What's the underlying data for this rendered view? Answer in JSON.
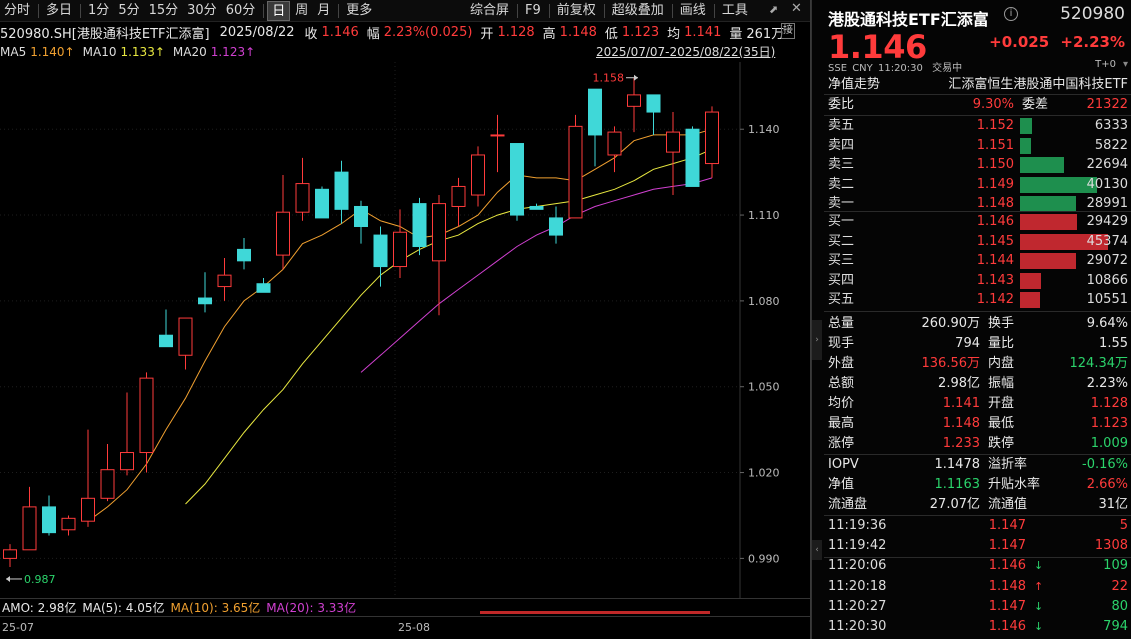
{
  "toolbar": {
    "periods": [
      "分时",
      "多日",
      "1分",
      "5分",
      "15分",
      "30分",
      "60分",
      "日",
      "周",
      "月",
      "更多"
    ],
    "active_period": "日",
    "tools": [
      "综合屏",
      "F9",
      "前复权",
      "超级叠加",
      "画线",
      "工具"
    ]
  },
  "info": {
    "code_name": "520980.SH[港股通科技ETF汇添富]",
    "date": "2025/08/22",
    "close_label": "收",
    "close": "1.146",
    "change_label": "幅",
    "change": "2.23%(0.025)",
    "open_label": "开",
    "open": "1.128",
    "high_label": "高",
    "high": "1.148",
    "low_label": "低",
    "low": "1.123",
    "avg_label": "均",
    "avg": "1.141",
    "vol_label": "量",
    "vol": "261万",
    "range": "2025/07/07-2025/08/22(35日)"
  },
  "ma": {
    "ma5_label": "MA5",
    "ma5": "1.140↑",
    "ma10_label": "MA10",
    "ma10": "1.133↑",
    "ma20_label": "MA20",
    "ma20": "1.123↑"
  },
  "colors": {
    "up": "#ff3b3b",
    "down": "#3fd8d8",
    "ma5": "#f0a030",
    "ma10": "#e8e840",
    "ma20": "#d040d0",
    "bid_bar": "#c0282f",
    "ask_bar": "#1e8f4e"
  },
  "chart_data": {
    "type": "candlestick",
    "ylim": [
      0.98,
      1.16
    ],
    "yticks": [
      "1.140",
      "1.110",
      "1.080",
      "1.050",
      "1.020",
      "0.990"
    ],
    "ytick_values": [
      1.14,
      1.11,
      1.08,
      1.05,
      1.02,
      0.99
    ],
    "xlabels": [
      "25-07",
      "25-08"
    ],
    "max_label": "1.158",
    "min_label": "0.987",
    "candles": [
      {
        "o": 0.99,
        "h": 0.995,
        "l": 0.987,
        "c": 0.993
      },
      {
        "o": 0.993,
        "h": 1.015,
        "l": 0.993,
        "c": 1.008
      },
      {
        "o": 1.008,
        "h": 1.012,
        "l": 0.998,
        "c": 0.999
      },
      {
        "o": 1.0,
        "h": 1.005,
        "l": 0.998,
        "c": 1.004
      },
      {
        "o": 1.003,
        "h": 1.035,
        "l": 1.001,
        "c": 1.011
      },
      {
        "o": 1.011,
        "h": 1.03,
        "l": 1.01,
        "c": 1.021
      },
      {
        "o": 1.021,
        "h": 1.048,
        "l": 1.019,
        "c": 1.027
      },
      {
        "o": 1.027,
        "h": 1.055,
        "l": 1.02,
        "c": 1.053
      },
      {
        "o": 1.068,
        "h": 1.077,
        "l": 1.066,
        "c": 1.064
      },
      {
        "o": 1.061,
        "h": 1.07,
        "l": 1.056,
        "c": 1.074
      },
      {
        "o": 1.081,
        "h": 1.09,
        "l": 1.076,
        "c": 1.079
      },
      {
        "o": 1.085,
        "h": 1.095,
        "l": 1.08,
        "c": 1.089
      },
      {
        "o": 1.098,
        "h": 1.102,
        "l": 1.091,
        "c": 1.094
      },
      {
        "o": 1.086,
        "h": 1.088,
        "l": 1.083,
        "c": 1.083
      },
      {
        "o": 1.096,
        "h": 1.124,
        "l": 1.091,
        "c": 1.111
      },
      {
        "o": 1.111,
        "h": 1.13,
        "l": 1.108,
        "c": 1.121
      },
      {
        "o": 1.119,
        "h": 1.12,
        "l": 1.11,
        "c": 1.109
      },
      {
        "o": 1.125,
        "h": 1.129,
        "l": 1.107,
        "c": 1.112
      },
      {
        "o": 1.113,
        "h": 1.115,
        "l": 1.1,
        "c": 1.106
      },
      {
        "o": 1.103,
        "h": 1.106,
        "l": 1.085,
        "c": 1.092
      },
      {
        "o": 1.092,
        "h": 1.112,
        "l": 1.088,
        "c": 1.104
      },
      {
        "o": 1.114,
        "h": 1.116,
        "l": 1.096,
        "c": 1.099
      },
      {
        "o": 1.094,
        "h": 1.117,
        "l": 1.075,
        "c": 1.114
      },
      {
        "o": 1.113,
        "h": 1.123,
        "l": 1.106,
        "c": 1.12
      },
      {
        "o": 1.117,
        "h": 1.134,
        "l": 1.113,
        "c": 1.131
      },
      {
        "o": 1.138,
        "h": 1.145,
        "l": 1.125,
        "c": 1.138
      },
      {
        "o": 1.135,
        "h": 1.132,
        "l": 1.108,
        "c": 1.11
      },
      {
        "o": 1.113,
        "h": 1.114,
        "l": 1.112,
        "c": 1.112
      },
      {
        "o": 1.109,
        "h": 1.113,
        "l": 1.1,
        "c": 1.103
      },
      {
        "o": 1.109,
        "h": 1.145,
        "l": 1.11,
        "c": 1.141
      },
      {
        "o": 1.154,
        "h": 1.154,
        "l": 1.127,
        "c": 1.138
      },
      {
        "o": 1.131,
        "h": 1.141,
        "l": 1.125,
        "c": 1.139
      },
      {
        "o": 1.148,
        "h": 1.158,
        "l": 1.139,
        "c": 1.152
      },
      {
        "o": 1.152,
        "h": 1.152,
        "l": 1.138,
        "c": 1.146
      },
      {
        "o": 1.132,
        "h": 1.146,
        "l": 1.117,
        "c": 1.139
      },
      {
        "o": 1.14,
        "h": 1.141,
        "l": 1.12,
        "c": 1.12
      },
      {
        "o": 1.128,
        "h": 1.148,
        "l": 1.123,
        "c": 1.146
      }
    ],
    "ma5": [
      null,
      null,
      null,
      null,
      1.003,
      1.008,
      1.014,
      1.023,
      1.035,
      1.046,
      1.059,
      1.071,
      1.08,
      1.085,
      1.091,
      1.1,
      1.103,
      1.107,
      1.112,
      1.108,
      1.106,
      1.102,
      1.103,
      1.106,
      1.11,
      1.118,
      1.124,
      1.123,
      1.123,
      1.122,
      1.126,
      1.13,
      1.136,
      1.138,
      1.138,
      1.138,
      1.14
    ],
    "ma10": [
      null,
      null,
      null,
      null,
      null,
      null,
      null,
      null,
      null,
      1.009,
      1.016,
      1.025,
      1.034,
      1.042,
      1.049,
      1.058,
      1.066,
      1.074,
      1.082,
      1.089,
      1.094,
      1.098,
      1.101,
      1.103,
      1.107,
      1.11,
      1.112,
      1.113,
      1.114,
      1.115,
      1.117,
      1.119,
      1.122,
      1.126,
      1.128,
      1.13,
      1.133
    ],
    "ma20": [
      null,
      null,
      null,
      null,
      null,
      null,
      null,
      null,
      null,
      null,
      null,
      null,
      null,
      null,
      null,
      null,
      null,
      null,
      1.055,
      1.061,
      1.067,
      1.073,
      1.079,
      1.084,
      1.089,
      1.094,
      1.099,
      1.103,
      1.106,
      1.11,
      1.113,
      1.115,
      1.117,
      1.119,
      1.12,
      1.121,
      1.123
    ]
  },
  "amo": {
    "label": "AMO: 2.98亿",
    "ma5": "MA(5): 4.05亿",
    "ma10": "MA(10): 3.65亿",
    "ma20": "MA(20): 3.33亿"
  },
  "panel": {
    "name": "港股通科技ETF汇添富",
    "code": "520980",
    "price": "1.146",
    "change": "+0.025",
    "change_pct": "+2.23%",
    "exchange": "SSE",
    "currency": "CNY",
    "time": "11:20:30",
    "status": "交易中",
    "t0": "T+0",
    "nav_trend": "净值走势",
    "fund_full_name": "汇添富恒生港股通中国科技ETF",
    "weibi_label": "委比",
    "weibi": "9.30%",
    "weicha_label": "委差",
    "weicha": "21322",
    "asks": [
      {
        "label": "卖五",
        "price": "1.152",
        "vol": "6333",
        "bar": 0.14
      },
      {
        "label": "卖四",
        "price": "1.151",
        "vol": "5822",
        "bar": 0.13
      },
      {
        "label": "卖三",
        "price": "1.150",
        "vol": "22694",
        "bar": 0.5
      },
      {
        "label": "卖二",
        "price": "1.149",
        "vol": "40130",
        "bar": 0.88
      },
      {
        "label": "卖一",
        "price": "1.148",
        "vol": "28991",
        "bar": 0.64
      }
    ],
    "bids": [
      {
        "label": "买一",
        "price": "1.146",
        "vol": "29429",
        "bar": 0.65
      },
      {
        "label": "买二",
        "price": "1.145",
        "vol": "45374",
        "bar": 1.0
      },
      {
        "label": "买三",
        "price": "1.144",
        "vol": "29072",
        "bar": 0.64
      },
      {
        "label": "买四",
        "price": "1.143",
        "vol": "10866",
        "bar": 0.24
      },
      {
        "label": "买五",
        "price": "1.142",
        "vol": "10551",
        "bar": 0.23
      }
    ],
    "stats": [
      {
        "k1": "总量",
        "v1": "260.90万",
        "c1": "white",
        "k2": "换手",
        "v2": "9.64%",
        "c2": "white"
      },
      {
        "k1": "现手",
        "v1": "794",
        "c1": "white",
        "k2": "量比",
        "v2": "1.55",
        "c2": "white"
      },
      {
        "k1": "外盘",
        "v1": "136.56万",
        "c1": "red",
        "k2": "内盘",
        "v2": "124.34万",
        "c2": "green"
      },
      {
        "k1": "总额",
        "v1": "2.98亿",
        "c1": "white",
        "k2": "振幅",
        "v2": "2.23%",
        "c2": "white"
      },
      {
        "k1": "均价",
        "v1": "1.141",
        "c1": "red",
        "k2": "开盘",
        "v2": "1.128",
        "c2": "red"
      },
      {
        "k1": "最高",
        "v1": "1.148",
        "c1": "red",
        "k2": "最低",
        "v2": "1.123",
        "c2": "red"
      },
      {
        "k1": "涨停",
        "v1": "1.233",
        "c1": "red",
        "k2": "跌停",
        "v2": "1.009",
        "c2": "green"
      }
    ],
    "stats2": [
      {
        "k1": "IOPV",
        "v1": "1.1478",
        "c1": "white",
        "k2": "溢折率",
        "v2": "-0.16%",
        "c2": "green"
      },
      {
        "k1": "净值",
        "v1": "1.1163",
        "c1": "green",
        "k2": "升贴水率",
        "v2": "2.66%",
        "c2": "red"
      },
      {
        "k1": "流通盘",
        "v1": "27.07亿",
        "c1": "white",
        "k2": "流通值",
        "v2": "31亿",
        "c2": "white"
      }
    ],
    "ticks": [
      {
        "time": "11:19:36",
        "price": "1.147",
        "arrow": "",
        "vol": "5",
        "vc": "red"
      },
      {
        "time": "11:19:42",
        "price": "1.147",
        "arrow": "",
        "vol": "1308",
        "vc": "red"
      },
      {
        "time": "11:20:06",
        "price": "1.146",
        "arrow": "↓",
        "vol": "109",
        "vc": "green"
      },
      {
        "time": "11:20:18",
        "price": "1.148",
        "arrow": "↑",
        "vol": "22",
        "vc": "red"
      },
      {
        "time": "11:20:27",
        "price": "1.147",
        "arrow": "↓",
        "vol": "80",
        "vc": "green"
      },
      {
        "time": "11:20:30",
        "price": "1.146",
        "arrow": "↓",
        "vol": "794",
        "vc": "green"
      }
    ]
  }
}
